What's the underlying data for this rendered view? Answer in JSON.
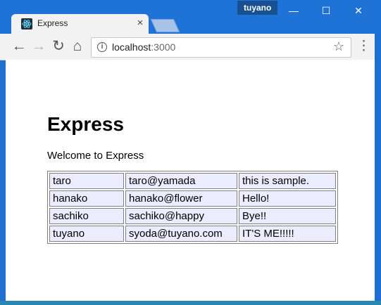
{
  "browser": {
    "user_badge": "tuyano",
    "window_controls": {
      "minimize_icon": "minimize-icon",
      "maximize_icon": "maximize-icon",
      "close_icon": "close-icon"
    },
    "tab": {
      "title": "Express",
      "favicon": "react-logo-icon",
      "close_symbol": "×"
    },
    "toolbar": {
      "back_icon": "back-arrow-icon",
      "forward_icon": "forward-arrow-icon",
      "reload_icon": "reload-icon",
      "home_icon": "home-icon",
      "info_icon": "info-icon",
      "bookmark_icon": "star-icon",
      "menu_icon": "more-vert-icon",
      "url_host": "localhost",
      "url_port": ":3000"
    }
  },
  "page": {
    "title": "Express",
    "welcome": "Welcome to Express",
    "table": {
      "rows": [
        {
          "name": "taro",
          "email": "taro@yamada",
          "message": "this is sample."
        },
        {
          "name": "hanako",
          "email": "hanako@flower",
          "message": "Hello!"
        },
        {
          "name": "sachiko",
          "email": "sachiko@happy",
          "message": "Bye!!"
        },
        {
          "name": "tuyano",
          "email": "syoda@tuyano.com",
          "message": "IT'S ME!!!!!"
        }
      ]
    }
  },
  "colors": {
    "window_frame": "#1f73d6",
    "toolbar": "#f2f2f2",
    "table_cell_background": "#ececff"
  }
}
